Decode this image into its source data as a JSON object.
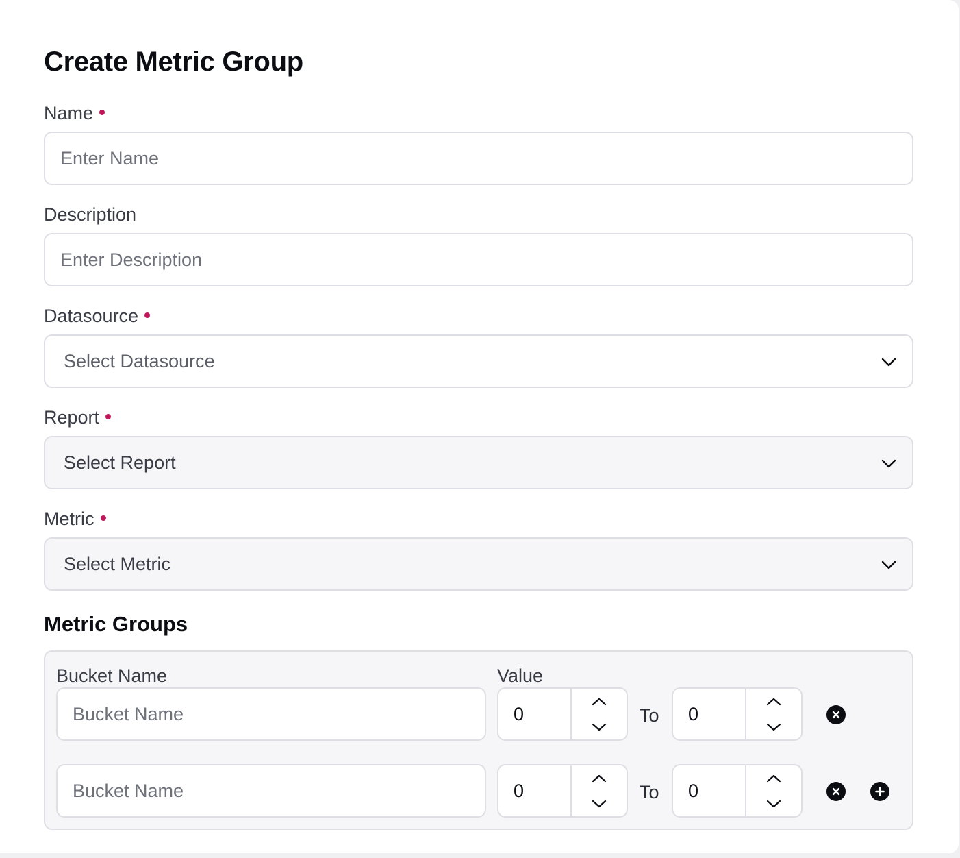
{
  "page": {
    "title": "Create Metric Group"
  },
  "form": {
    "name": {
      "label": "Name",
      "required": true,
      "placeholder": "Enter Name",
      "value": ""
    },
    "description": {
      "label": "Description",
      "required": false,
      "placeholder": "Enter Description",
      "value": ""
    },
    "datasource": {
      "label": "Datasource",
      "required": true,
      "selected": "Select Datasource",
      "icon": "chevron-down-icon"
    },
    "report": {
      "label": "Report",
      "required": true,
      "selected": "Select Report",
      "icon": "chevron-down-icon",
      "disabled_look": true
    },
    "metric": {
      "label": "Metric",
      "required": true,
      "selected": "Select Metric",
      "icon": "chevron-down-icon",
      "disabled_look": true
    }
  },
  "metric_groups": {
    "title": "Metric Groups",
    "bucket_column_label": "Bucket Name",
    "value_column_label": "Value",
    "to_label": "To",
    "rows": [
      {
        "bucket_placeholder": "Bucket Name",
        "bucket_value": "",
        "from": "0",
        "to": "0",
        "actions": [
          "remove-icon"
        ]
      },
      {
        "bucket_placeholder": "Bucket Name",
        "bucket_value": "",
        "from": "0",
        "to": "0",
        "actions": [
          "remove-icon",
          "add-icon"
        ]
      }
    ]
  },
  "colors": {
    "required_dot": "#c2185b",
    "border": "#dedfe4",
    "muted_background": "#f6f6f8",
    "text": "#2b2d36",
    "icon_fill": "#0c0d12"
  }
}
